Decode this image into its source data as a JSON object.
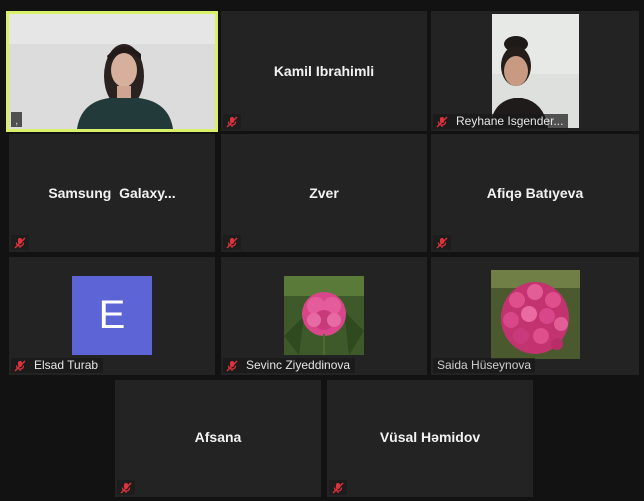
{
  "participants": [
    {
      "name": "",
      "label": ",",
      "active": true,
      "video": true
    },
    {
      "name": "Kamil Ibrahimli",
      "label": "",
      "muted": true
    },
    {
      "name": "",
      "label": "Reyhane Isgender...",
      "muted": true,
      "video": true
    },
    {
      "name": "Samsung  Galaxy...",
      "label": "",
      "muted": true
    },
    {
      "name": "Zver",
      "label": "",
      "muted": true
    },
    {
      "name": "Afiqə Batıyeva",
      "label": "",
      "muted": true
    },
    {
      "name": "",
      "label": "Elsad Turab",
      "muted": true,
      "avatar": "letter-E",
      "avatar_letter": "E"
    },
    {
      "name": "",
      "label": "Sevinc Ziyeddinova",
      "muted": true,
      "avatar": "pink-flower-photo"
    },
    {
      "name": "",
      "label": "Saida Hüseynova",
      "muted": false,
      "avatar": "pink-flower-bouquet-photo"
    },
    {
      "name": "Afsana",
      "label": "",
      "muted": true
    },
    {
      "name": "Vüsal Həmidov",
      "label": "",
      "muted": true
    }
  ],
  "colors": {
    "background": "#121212",
    "tile": "#232323",
    "active_speaker_border": "#d8f06a",
    "muted_mic": "#e0323c",
    "avatar_letter_bg": "#5d64d6"
  },
  "icons": {
    "muted": "muted-mic-icon"
  }
}
